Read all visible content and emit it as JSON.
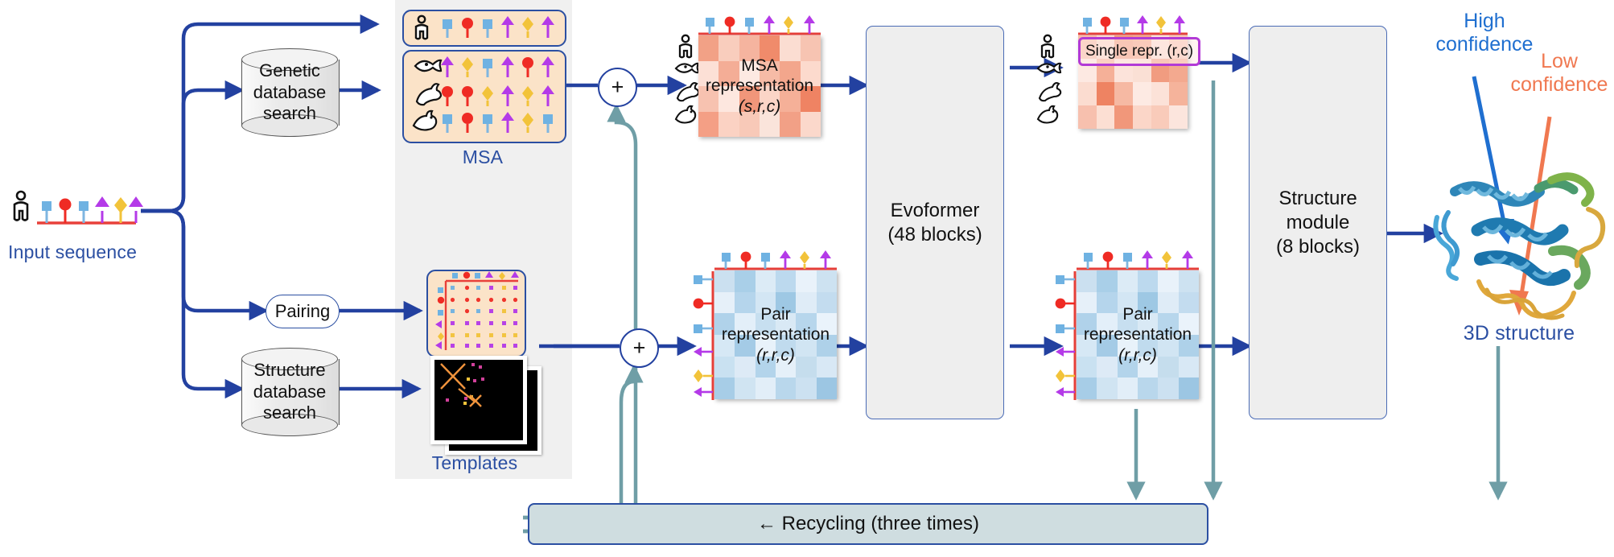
{
  "diagram": {
    "title": "AlphaFold 2 model architecture",
    "colors": {
      "blue_label": "#2b4fa2",
      "arrow_blue": "#2341a0",
      "recycle_teal": "#6f9ea6",
      "msa_fill": "#fbe3c8",
      "module_fill": "#eeeeee",
      "panel_gray": "#f0f0f0",
      "single_repr_outline": "#b23ad6",
      "high_confidence": "#1f6fd0",
      "low_confidence": "#f07850",
      "msa_rep_tile": "#f4a58a",
      "pair_rep_tile": "#b7d6ea"
    }
  },
  "input": {
    "label": "Input sequence"
  },
  "databases": {
    "genetic": {
      "line1": "Genetic",
      "line2": "database",
      "line3": "search"
    },
    "structure": {
      "line1": "Structure",
      "line2": "database",
      "line3": "search"
    },
    "pairing": {
      "label": "Pairing"
    }
  },
  "panel": {
    "msa_label": "MSA",
    "templates_label": "Templates",
    "msa_rows": [
      {
        "organism": "human-icon",
        "residues": [
          "square-blue",
          "circle-red",
          "square-blue",
          "arrow-purple",
          "diamond-yellow",
          "arrow-purple"
        ]
      },
      {
        "organism": "fish-icon",
        "residues": [
          "arrow-purple",
          "diamond-yellow",
          "square-blue",
          "arrow-purple",
          "circle-red",
          "arrow-purple"
        ]
      },
      {
        "organism": "rabbit-icon",
        "residues": [
          "circle-red",
          "circle-red",
          "diamond-yellow",
          "arrow-purple",
          "diamond-yellow",
          "arrow-purple"
        ]
      },
      {
        "organism": "rooster-icon",
        "residues": [
          "square-blue",
          "circle-red",
          "square-blue",
          "arrow-purple",
          "diamond-yellow",
          "square-blue"
        ]
      }
    ]
  },
  "operators": {
    "plus_top": "+",
    "plus_bottom": "+"
  },
  "representations": {
    "msa": {
      "line1": "MSA",
      "line2": "representation",
      "line3": "(s,r,c)"
    },
    "pair_left": {
      "line1": "Pair",
      "line2": "representation",
      "line3": "(r,r,c)"
    },
    "single": {
      "label": "Single repr. (r,c)"
    },
    "pair_right": {
      "line1": "Pair",
      "line2": "representation",
      "line3": "(r,r,c)"
    }
  },
  "modules": {
    "evoformer": {
      "line1": "Evoformer",
      "line2": "(48 blocks)"
    },
    "structure": {
      "line1": "Structure",
      "line2": "module",
      "line3": "(8 blocks)"
    }
  },
  "recycling": {
    "label": "← Recycling (three times)"
  },
  "output": {
    "structure_label": "3D structure",
    "high_confidence": {
      "line1": "High",
      "line2": "confidence"
    },
    "low_confidence": {
      "line1": "Low",
      "line2": "confidence"
    }
  }
}
